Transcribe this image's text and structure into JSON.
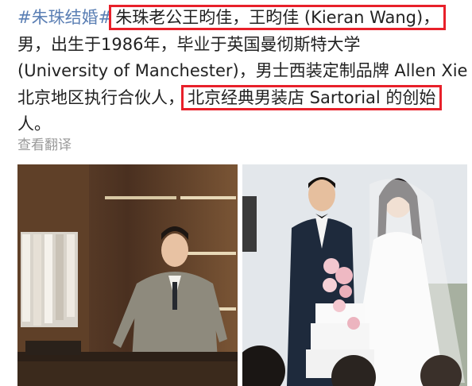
{
  "post": {
    "hashtag": "#朱珠结婚#",
    "highlight_1": "朱珠老公王昀佳，王昀佳 (Kieran Wang)，",
    "line_2": "男，出生于1986年，毕业于英国曼彻斯特大学",
    "line_3": "(University of Manchester)，男士西装定制品牌 Allen Xie",
    "line_4_prefix": "北京地区执行合伙人，",
    "highlight_2": "北京经典男装店 Sartorial 的创始",
    "line_5": "人。"
  },
  "actions": {
    "translate": "查看翻译"
  },
  "colors": {
    "hashtag": "#5b7fb4",
    "highlight_box": "#e8202a",
    "text": "#222222",
    "muted": "#9a9a9a"
  }
}
